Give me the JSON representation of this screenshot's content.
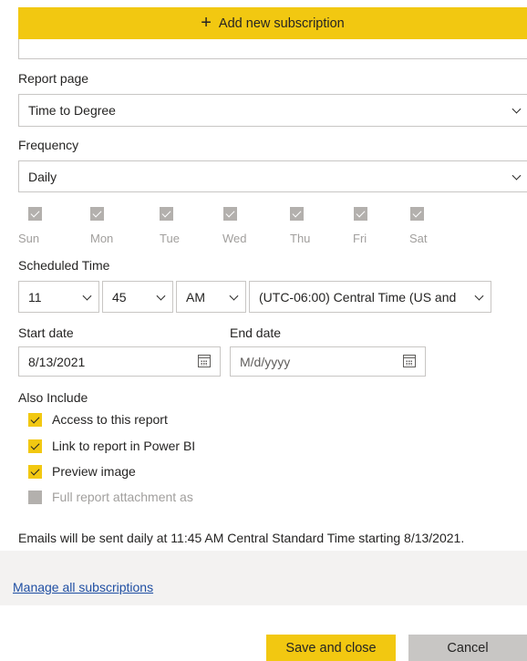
{
  "add_bar": {
    "icon": "plus-icon",
    "label": "Add new subscription"
  },
  "report_page": {
    "label": "Report page",
    "value": "Time to Degree"
  },
  "frequency": {
    "label": "Frequency",
    "value": "Daily"
  },
  "days": [
    {
      "label": "Sun",
      "checked": true
    },
    {
      "label": "Mon",
      "checked": true
    },
    {
      "label": "Tue",
      "checked": true
    },
    {
      "label": "Wed",
      "checked": true
    },
    {
      "label": "Thu",
      "checked": true
    },
    {
      "label": "Fri",
      "checked": true
    },
    {
      "label": "Sat",
      "checked": true
    }
  ],
  "scheduled_time": {
    "label": "Scheduled Time",
    "hour": "11",
    "minute": "45",
    "ampm": "AM",
    "timezone": "(UTC-06:00) Central Time (US and"
  },
  "start_date": {
    "label": "Start date",
    "value": "8/13/2021"
  },
  "end_date": {
    "label": "End date",
    "placeholder": "M/d/yyyy"
  },
  "also_include": {
    "label": "Also Include",
    "options": [
      {
        "label": "Access to this report",
        "checked": true,
        "disabled": false
      },
      {
        "label": "Link to report in Power BI",
        "checked": true,
        "disabled": false
      },
      {
        "label": "Preview image",
        "checked": true,
        "disabled": false
      },
      {
        "label": "Full report attachment as",
        "checked": false,
        "disabled": true
      }
    ]
  },
  "summary": "Emails will be sent daily at 11:45 AM Central Standard Time starting 8/13/2021.",
  "manage_link": "Manage all subscriptions",
  "buttons": {
    "save": "Save and close",
    "cancel": "Cancel"
  },
  "colors": {
    "accent": "#f2c811",
    "link": "#1f4fa3",
    "disabled": "#b3b0ad",
    "text": "#252423"
  }
}
